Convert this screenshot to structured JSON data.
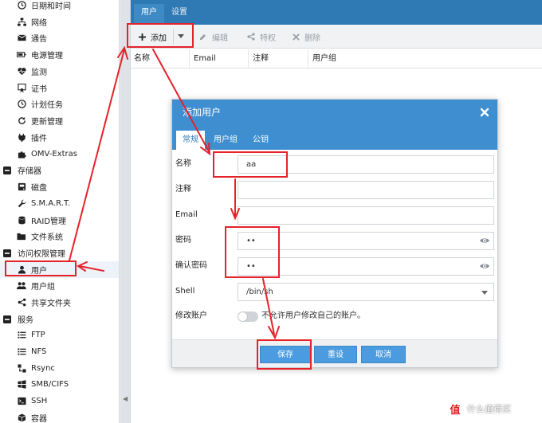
{
  "sidebar": {
    "items": [
      {
        "label": "日期和时间",
        "icon": "clock-icon"
      },
      {
        "label": "网络",
        "icon": "network-icon"
      },
      {
        "label": "通告",
        "icon": "mail-icon"
      },
      {
        "label": "电源管理",
        "icon": "battery-icon"
      },
      {
        "label": "监测",
        "icon": "heartbeat-icon"
      },
      {
        "label": "证书",
        "icon": "certificate-icon"
      },
      {
        "label": "计划任务",
        "icon": "clock-icon"
      },
      {
        "label": "更新管理",
        "icon": "refresh-icon"
      },
      {
        "label": "插件",
        "icon": "plug-icon"
      },
      {
        "label": "OMV-Extras",
        "icon": "puzzle-icon"
      },
      {
        "label": "存储器",
        "icon": "minus-square-icon"
      },
      {
        "label": "磁盘",
        "icon": "disk-icon"
      },
      {
        "label": "S.M.A.R.T.",
        "icon": "wrench-icon"
      },
      {
        "label": "RAID管理",
        "icon": "database-icon"
      },
      {
        "label": "文件系统",
        "icon": "folder-icon"
      },
      {
        "label": "访问权限管理",
        "icon": "minus-square-icon"
      },
      {
        "label": "用户",
        "icon": "user-icon"
      },
      {
        "label": "用户组",
        "icon": "users-icon"
      },
      {
        "label": "共享文件夹",
        "icon": "share-icon"
      },
      {
        "label": "服务",
        "icon": "minus-square-icon"
      },
      {
        "label": "FTP",
        "icon": "list-icon"
      },
      {
        "label": "NFS",
        "icon": "list-icon"
      },
      {
        "label": "Rsync",
        "icon": "rsync-icon"
      },
      {
        "label": "SMB/CIFS",
        "icon": "windows-icon"
      },
      {
        "label": "SSH",
        "icon": "terminal-icon"
      },
      {
        "label": "容器",
        "icon": "container-icon"
      }
    ]
  },
  "main": {
    "tabs": [
      "用户",
      "设置"
    ],
    "toolbar": {
      "add_label": "添加",
      "edit_label": "编辑",
      "privileges_label": "特权",
      "delete_label": "删除"
    },
    "columns": [
      "名称",
      "Email",
      "注释",
      "用户组"
    ]
  },
  "dialog": {
    "title": "添加用户",
    "tabs": [
      "常规",
      "用户组",
      "公钥"
    ],
    "fields": {
      "name_label": "名称",
      "name_value": "aa",
      "comment_label": "注释",
      "comment_value": "",
      "email_label": "Email",
      "email_value": "",
      "password_label": "密码",
      "password_value": "••",
      "confirm_label": "确认密码",
      "confirm_value": "••",
      "shell_label": "Shell",
      "shell_value": "/bin/sh",
      "modify_label": "修改账户",
      "modify_toggle_text": "不允许用户修改自己的账户。"
    },
    "buttons": {
      "save": "保存",
      "reset": "重设",
      "cancel": "取消"
    }
  },
  "colors": {
    "header_blue": "#2f7ab5",
    "dialog_blue": "#3e8ed0",
    "button_blue": "#4a9be0",
    "annotation_red": "#e5222a"
  },
  "watermark": {
    "text": "什么值得买",
    "logo": "值"
  }
}
